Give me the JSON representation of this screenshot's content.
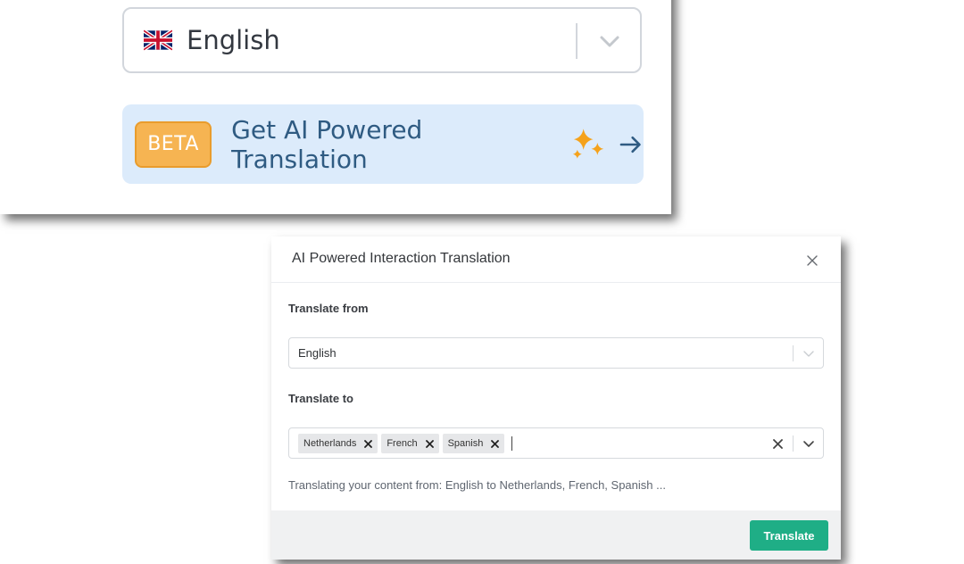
{
  "top_card": {
    "language_select": {
      "flag_icon": "uk-flag-icon",
      "value": "English",
      "chevron_icon": "chevron-down-icon"
    },
    "ai_banner": {
      "badge": "BETA",
      "text": "Get AI Powered Translation",
      "sparkle_icon": "sparkles-icon",
      "arrow_icon": "arrow-right-icon"
    }
  },
  "modal": {
    "title": "AI Powered Interaction Translation",
    "close_icon": "close-icon",
    "translate_from": {
      "label": "Translate from",
      "value": "English"
    },
    "translate_to": {
      "label": "Translate to",
      "tags": [
        "Netherlands",
        "French",
        "Spanish"
      ]
    },
    "info_text": "Translating your content from: English to Netherlands, French, Spanish ...",
    "translate_button": "Translate"
  },
  "colors": {
    "banner_bg": "#dcebfb",
    "banner_text": "#2f5b82",
    "beta_badge": "#f6b452",
    "sparkle": "#f5a21b",
    "translate_button": "#1fae86"
  }
}
